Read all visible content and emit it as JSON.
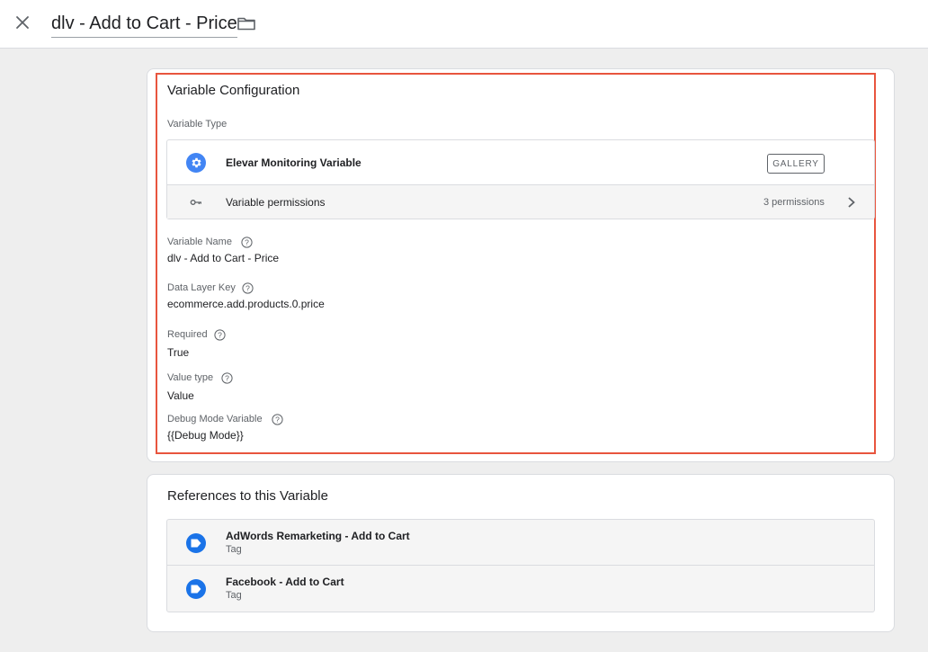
{
  "header": {
    "title": "dlv - Add to Cart - Price",
    "close_icon": "close-icon",
    "folder_icon": "folder-icon"
  },
  "config": {
    "section_title": "Variable Configuration",
    "variable_type_label": "Variable Type",
    "variable_type_name": "Elevar Monitoring Variable",
    "variable_type_icon": "gear-icon",
    "gallery_label": "GALLERY",
    "permissions_label": "Variable permissions",
    "permissions_count": "3 permissions",
    "fields": [
      {
        "label": "Variable Name",
        "value": "dlv - Add to Cart - Price"
      },
      {
        "label": "Data Layer Key",
        "value": "ecommerce.add.products.0.price"
      },
      {
        "label": "Required",
        "value": "True"
      },
      {
        "label": "Value type",
        "value": "Value"
      },
      {
        "label": "Debug Mode Variable",
        "value": "{{Debug Mode}}"
      }
    ]
  },
  "references": {
    "section_title": "References to this Variable",
    "items": [
      {
        "name": "AdWords Remarketing - Add to Cart",
        "type": "Tag"
      },
      {
        "name": "Facebook - Add to Cart",
        "type": "Tag"
      }
    ]
  },
  "colors": {
    "accent_blue": "#4285f4",
    "tag_blue": "#1a73e8",
    "highlight_red": "#e8553e"
  }
}
